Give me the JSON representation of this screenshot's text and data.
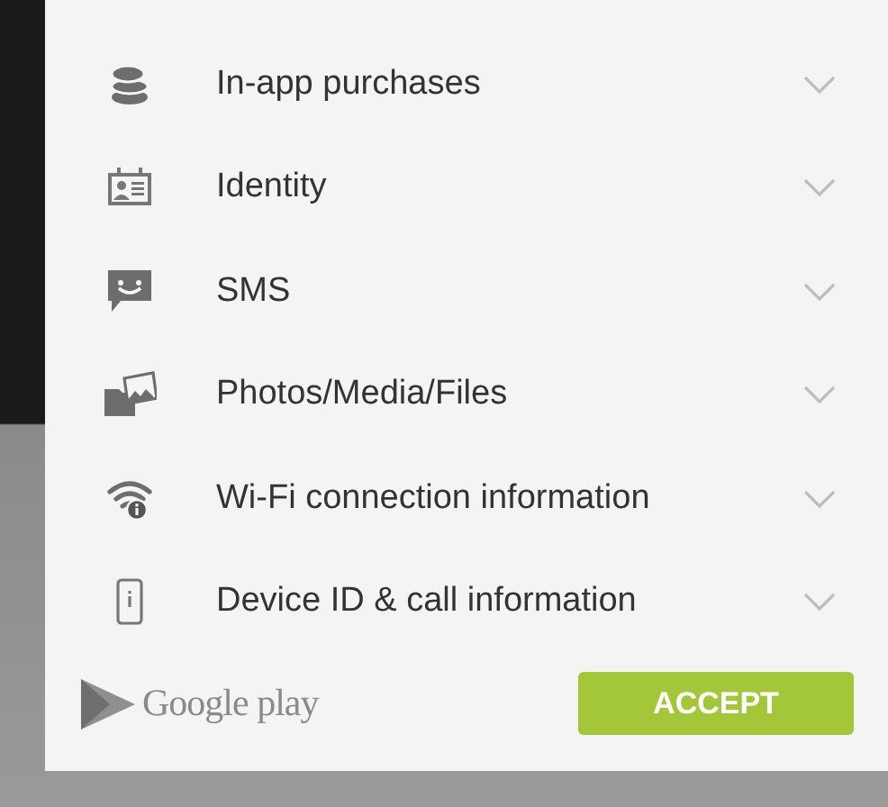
{
  "permissions": [
    {
      "label": "In-app purchases",
      "expanded": false
    },
    {
      "label": "Identity",
      "expanded": false
    },
    {
      "label": "SMS",
      "expanded": false
    },
    {
      "label": "Photos/Media/Files",
      "expanded": false
    },
    {
      "label": "Wi-Fi connection information",
      "expanded": false
    },
    {
      "label": "Device ID & call information",
      "expanded": false
    }
  ],
  "footer": {
    "brand": "Google play",
    "button": "ACCEPT"
  }
}
